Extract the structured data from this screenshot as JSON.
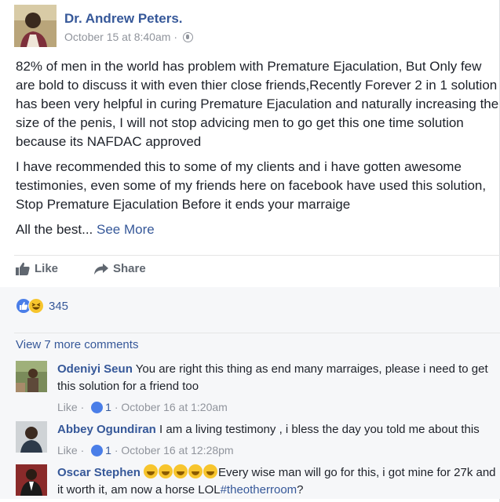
{
  "post": {
    "author": "Dr. Andrew Peters.",
    "timestamp": "October 15 at 8:40am",
    "separator": "·",
    "privacy_icon": "globe-icon",
    "paragraphs": [
      "82% of men in the world has problem with Premature Ejaculation, But Only few are bold to discuss it with even thier close friends,Recently Forever 2 in 1 solution has been very helpful in curing Premature Ejaculation and naturally increasing the size of the penis, I will not stop advicing men to go get this one time solution because its NAFDAC approved",
      "I have recommended this to some of my clients and i have gotten awesome testimonies, even some of my friends here on facebook have used this solution, Stop Premature Ejaculation Before it ends your marraige"
    ],
    "closing_text": "All the best...",
    "see_more": "See More"
  },
  "actions": {
    "like": "Like",
    "share": "Share"
  },
  "reactions": {
    "count": "345"
  },
  "comments_section": {
    "view_more": "View 7 more comments",
    "comments": [
      {
        "name": "Odeniyi Seun",
        "text": "You are right this thing as end many marraiges, please i need to get this solution for a friend too",
        "like_label": "Like",
        "likes": "1",
        "time": "October 16 at 1:20am"
      },
      {
        "name": "Abbey Ogundiran",
        "text": "I am a living testimony , i bless the day you told me about this",
        "like_label": "Like",
        "likes": "1",
        "time": "October 16 at 12:28pm"
      },
      {
        "name": "Oscar Stephen",
        "text": "Every wise man will go for this, i got mine for 27k and it worth it, am now a horse LOL",
        "hashtag": "#theotherroom",
        "trailing": "?"
      }
    ]
  },
  "colors": {
    "link": "#365899",
    "meta": "#90949c",
    "text": "#1d2129",
    "like_blue": "#4a7ee8",
    "haha_yellow": "#f7c52d"
  }
}
